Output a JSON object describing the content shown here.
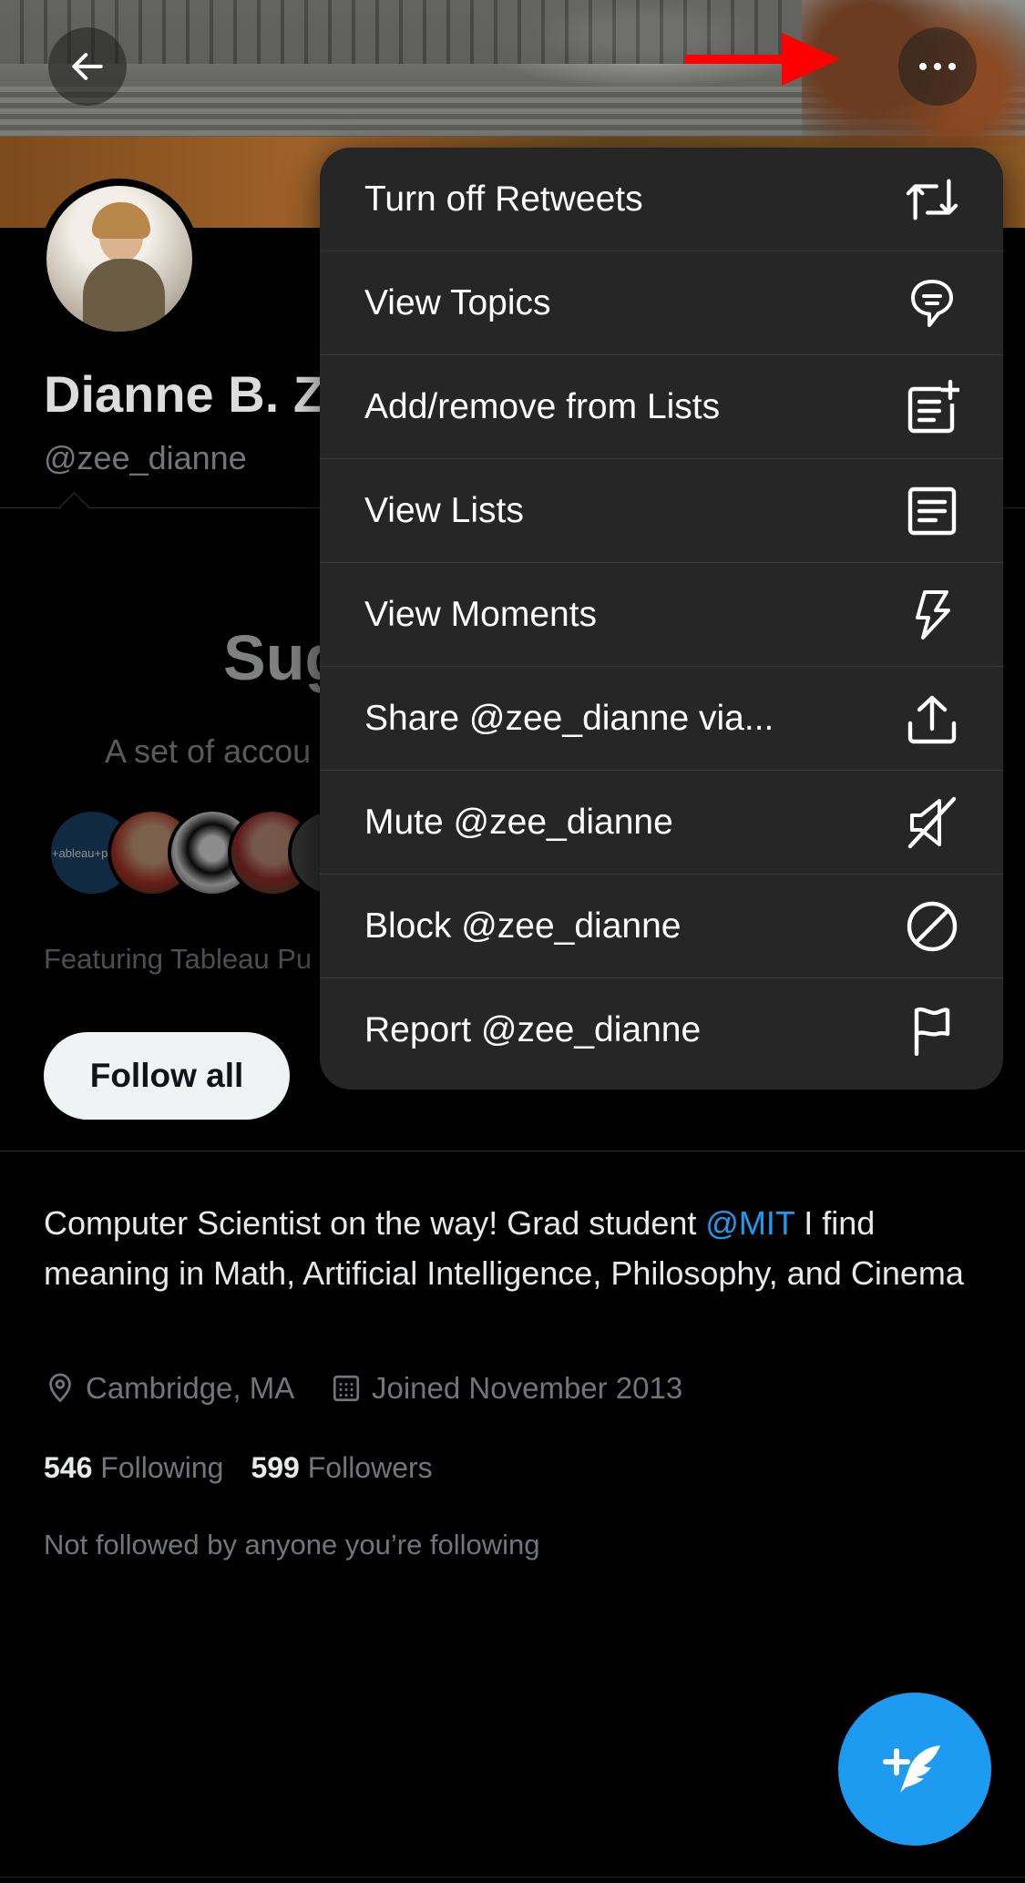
{
  "profile": {
    "name": "Dianne B. Z",
    "handle": "@zee_dianne"
  },
  "suggested": {
    "title": "Sug",
    "subtitle": "A set of accou",
    "featuring": "Featuring Tableau Pu",
    "follow_all_label": "Follow all",
    "avatar_1_text": "+ableau+public"
  },
  "bio": {
    "text_before": "Computer Scientist on the way! Grad student ",
    "mention": "@MIT",
    "text_after": " I find meaning in Math, Artificial Intelligence, Philosophy, and Cinema"
  },
  "meta": {
    "location": "Cambridge, MA",
    "joined": "Joined November 2013"
  },
  "counts": {
    "following_count": "546",
    "following_label": "Following",
    "followers_count": "599",
    "followers_label": "Followers"
  },
  "not_followed_text": "Not followed by anyone you’re following",
  "menu": {
    "items": [
      {
        "label": "Turn off Retweets",
        "icon": "retweet-icon"
      },
      {
        "label": "View Topics",
        "icon": "topics-icon"
      },
      {
        "label": "Add/remove from Lists",
        "icon": "add-to-list-icon"
      },
      {
        "label": "View Lists",
        "icon": "lists-icon"
      },
      {
        "label": "View Moments",
        "icon": "moments-icon"
      },
      {
        "label": "Share @zee_dianne via...",
        "icon": "share-icon"
      },
      {
        "label": "Mute @zee_dianne",
        "icon": "mute-icon"
      },
      {
        "label": "Block @zee_dianne",
        "icon": "block-icon"
      },
      {
        "label": "Report @zee_dianne",
        "icon": "report-flag-icon"
      }
    ]
  },
  "colors": {
    "accent": "#1d9bf0",
    "annotation_arrow": "#ff0000",
    "menu_bg": "#262626"
  }
}
